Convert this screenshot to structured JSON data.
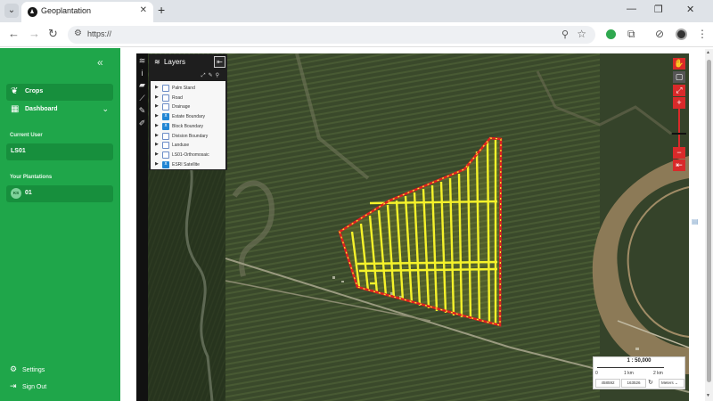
{
  "browser": {
    "tab_title": "Geoplantation",
    "url": "https://",
    "tab_menu_icon": "chevron-down-icon",
    "new_tab_icon": "plus-icon"
  },
  "sidebar": {
    "nav": [
      {
        "label": "Crops",
        "icon": "sprout-icon",
        "active": true
      },
      {
        "label": "Dashboard",
        "icon": "dashboard-icon",
        "active": false
      }
    ],
    "current_user_heading": "Current User",
    "current_user": "LS01",
    "plantations_heading": "Your Plantations",
    "plantation": {
      "badge": "KS",
      "name": "01"
    },
    "settings_label": "Settings",
    "signout_label": "Sign Out"
  },
  "layers": {
    "title": "Layers",
    "items": [
      {
        "name": "Palm Stand",
        "checked": false
      },
      {
        "name": "Road",
        "checked": false
      },
      {
        "name": "Drainage",
        "checked": false
      },
      {
        "name": "Estate Boundary",
        "checked": true
      },
      {
        "name": "Block Boundary",
        "checked": true
      },
      {
        "name": "Division Boundary",
        "checked": false
      },
      {
        "name": "Landuse",
        "checked": false
      },
      {
        "name": "LS01-Orthomosaic",
        "checked": false
      },
      {
        "name": "ESRI Satellite",
        "checked": true
      }
    ]
  },
  "scale": {
    "ratio": "1 : 50,000",
    "ticks": [
      "0",
      "1 km",
      "2 km"
    ],
    "coord_x": "458592",
    "coord_y": "163526",
    "units": "Meters"
  },
  "colors": {
    "sidebar_green": "#1fa64a",
    "block_yellow": "#f5f22a",
    "boundary_red": "#e02020"
  }
}
